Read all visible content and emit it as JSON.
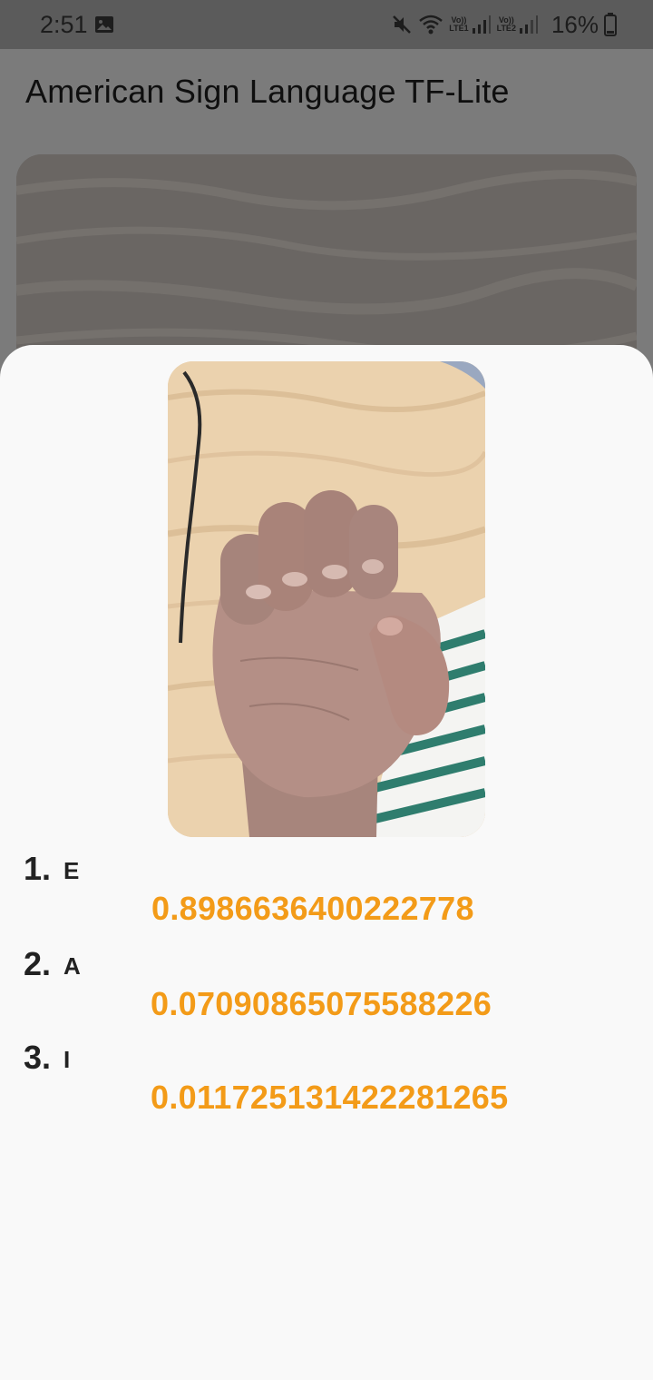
{
  "status_bar": {
    "time": "2:51",
    "gallery_icon": "image-icon",
    "mute_icon": "mute-icon",
    "wifi_icon": "wifi-icon",
    "sim1": {
      "top": "Vo))",
      "bottom": "LTE1"
    },
    "sim2": {
      "top": "Vo))",
      "bottom": "LTE2"
    },
    "battery_text": "16%",
    "battery_icon": "battery-icon"
  },
  "app_bar": {
    "title": "American Sign Language TF-Lite"
  },
  "sheet": {
    "photo": "hand-sign-photo",
    "results": [
      {
        "rank": "1.",
        "label": "E",
        "score": "0.8986636400222778"
      },
      {
        "rank": "2.",
        "label": "A",
        "score": "0.07090865075588226"
      },
      {
        "rank": "3.",
        "label": "I",
        "score": "0.011725131422281265"
      }
    ]
  },
  "colors": {
    "accent": "#f39b18",
    "scrim": "#7b7b7b",
    "sheet_background": "#f9f9f9",
    "text": "#222222"
  }
}
